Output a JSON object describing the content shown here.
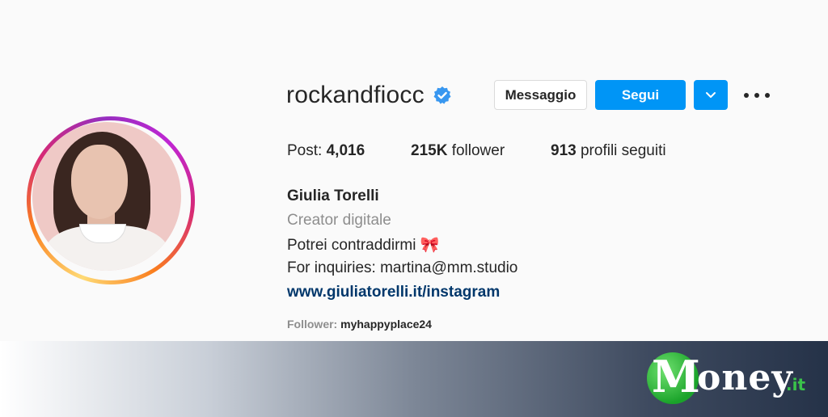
{
  "profile": {
    "username": "rockandfiocc",
    "verified_icon": "verified-badge-icon",
    "buttons": {
      "message": "Messaggio",
      "follow": "Segui",
      "dropdown_icon": "chevron-down-icon",
      "more_icon": "more-options-icon"
    },
    "stats": {
      "posts_label": "Post:",
      "posts_value": "4,016",
      "followers_value": "215K",
      "followers_label": "follower",
      "following_value": "913",
      "following_label": "profili seguiti"
    },
    "bio": {
      "name": "Giulia Torelli",
      "category": "Creator digitale",
      "line1": "Potrei contraddirmi 🎀",
      "line2": "For inquiries: martina@mm.studio",
      "link": "www.giuliatorelli.it/instagram"
    },
    "followed_by": {
      "label": "Follower:",
      "user": "myhappyplace24"
    }
  },
  "watermark": {
    "logo_initial": "M",
    "logo_rest": "oney",
    "logo_tld": ".it"
  },
  "colors": {
    "primary_button": "#0095f6",
    "link": "#00376b",
    "secondary_text": "#8e8e8e",
    "verified": "#3897f0",
    "logo_green": "#1aa32a"
  }
}
